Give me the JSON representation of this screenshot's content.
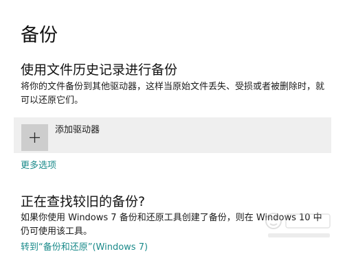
{
  "page": {
    "title": "备份"
  },
  "file_history": {
    "heading": "使用文件历史记录进行备份",
    "description": "将你的文件备份到其他驱动器，这样当原始文件丢失、受损或者被删除时，就可以还原它们。",
    "add_drive_label": "添加驱动器",
    "add_drive_icon": "plus-icon",
    "more_options_link": "更多选项"
  },
  "older_backup": {
    "heading": "正在查找较旧的备份?",
    "description": "如果你使用 Windows 7 备份和还原工具创建了备份，则在 Windows 10 中仍可使用该工具。",
    "restore_link": "转到“备份和还原”(Windows 7)"
  },
  "colors": {
    "background": "#ffffff",
    "tile_background": "#efefef",
    "icon_box": "#cdcdcd",
    "accent_link": "#1a8a8a",
    "text": "#111111"
  }
}
